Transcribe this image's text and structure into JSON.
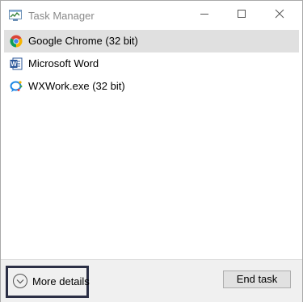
{
  "window": {
    "title": "Task Manager"
  },
  "titlebar": {
    "icons": [
      "task-manager-icon",
      "minimize-icon",
      "maximize-icon",
      "close-icon"
    ]
  },
  "apps": [
    {
      "name": "Google Chrome (32 bit)",
      "icon": "chrome-icon",
      "selected": true
    },
    {
      "name": "Microsoft Word",
      "icon": "word-icon",
      "selected": false
    },
    {
      "name": "WXWork.exe (32 bit)",
      "icon": "wxwork-icon",
      "selected": false
    }
  ],
  "footer": {
    "more_details_label": "More details",
    "more_details_icon": "chevron-down-circle-icon",
    "end_task_label": "End task"
  },
  "colors": {
    "selected_row": "#e0e0e0",
    "footer_bg": "#f0f0f0",
    "focus_outline": "#2b2f45",
    "title_text": "#8a8a8a"
  }
}
